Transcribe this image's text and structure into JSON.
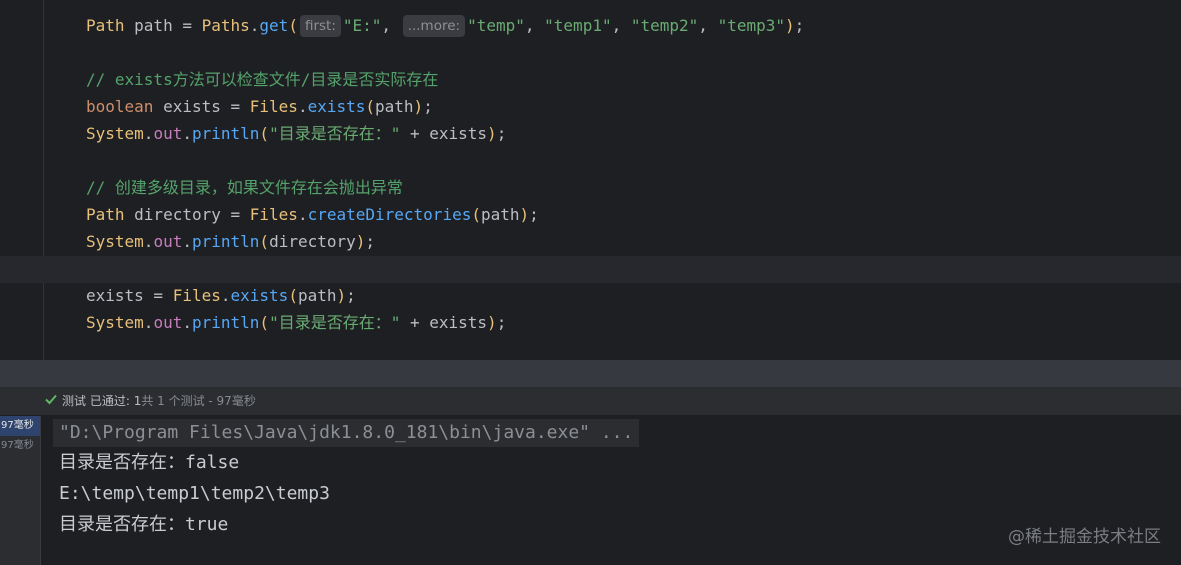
{
  "editor": {
    "line1": {
      "type": "Path",
      "var": " path = ",
      "cls": "Paths",
      "dot": ".",
      "method": "get",
      "open": "(",
      "hint1": "first:",
      "arg1": "\"E:\"",
      "comma1": ", ",
      "hint2": "...more:",
      "args": "\"temp\"",
      "c2": ", ",
      "a3": "\"temp1\"",
      "c3": ", ",
      "a4": "\"temp2\"",
      "c4": ", ",
      "a5": "\"temp3\"",
      "close": ")",
      "semi": ";"
    },
    "comment1": "// exists方法可以检查文件/目录是否实际存在",
    "line3": {
      "kw": "boolean",
      "var": " exists = ",
      "cls": "Files",
      "dot": ".",
      "method": "exists",
      "open": "(",
      "arg": "path",
      "close": ")",
      "semi": ";"
    },
    "line4": {
      "cls": "System",
      "dot1": ".",
      "field": "out",
      "dot2": ".",
      "method": "println",
      "open": "(",
      "str": "\"目录是否存在：\"",
      "rest": " + exists",
      "close": ")",
      "semi": ";"
    },
    "comment2": "// 创建多级目录，如果文件存在会抛出异常",
    "line6": {
      "type": "Path",
      "var": " directory = ",
      "cls": "Files",
      "dot": ".",
      "method": "createDirectories",
      "open": "(",
      "arg": "path",
      "close": ")",
      "semi": ";"
    },
    "line7": {
      "cls": "System",
      "dot1": ".",
      "field": "out",
      "dot2": ".",
      "method": "println",
      "open": "(",
      "arg": "directory",
      "close": ")",
      "semi": ";"
    },
    "line8": {
      "var": "exists = ",
      "cls": "Files",
      "dot": ".",
      "method": "exists",
      "open": "(",
      "arg": "path",
      "close": ")",
      "semi": ";"
    },
    "line9": {
      "cls": "System",
      "dot1": ".",
      "field": "out",
      "dot2": ".",
      "method": "println",
      "open": "(",
      "str": "\"目录是否存在：\"",
      "rest": " + exists",
      "close": ")",
      "semi": ";"
    }
  },
  "test_bar": {
    "status_icon": "check-icon",
    "label": "测试 已通过: ",
    "passed": "1",
    "detail": "共 1 个测试 - 97毫秒",
    "check_color": "#5fb865"
  },
  "left_pane": {
    "items": [
      "97毫秒",
      "97毫秒"
    ]
  },
  "console": {
    "command": "\"D:\\Program Files\\Java\\jdk1.8.0_181\\bin\\java.exe\" ...",
    "lines": [
      "目录是否存在：false",
      "E:\\temp\\temp1\\temp2\\temp3",
      "目录是否存在：true"
    ]
  },
  "watermark": "@稀土掘金技术社区"
}
